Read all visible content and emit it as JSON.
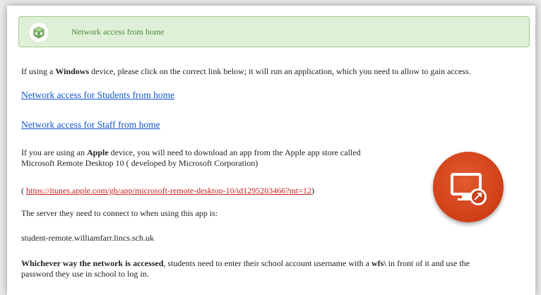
{
  "header": {
    "title": "Network access from home",
    "icon": "network-package-icon"
  },
  "intro": {
    "pre": "If using a ",
    "bold": "Windows",
    "post": " device, please click on the correct link below; it will run an application, which you need to allow to gain access."
  },
  "links": {
    "students": "Network access for Students from home",
    "staff": "Network access for Staff from home"
  },
  "apple": {
    "pre": "If you are using an ",
    "bold": "Apple",
    "post": " device, you will need to download an app from the Apple app store called",
    "line2": "Microsoft Remote Desktop 10 ( developed by Microsoft Corporation)",
    "url_open": "( ",
    "url": "https://itunes.apple.com/gb/app/microsoft-remote-desktop-10/id1295203466?mt=12",
    "url_close": ")"
  },
  "server": {
    "label": "The server they need to connect to when using this app is:",
    "host": "student-remote.williamfarr.lincs.sch.uk"
  },
  "footer": {
    "bold": "Whichever way the network is accessed",
    "mid": ", students need to enter their school account username with a ",
    "bold2": "wfs\\",
    "post": " in front of it and use the",
    "line2": "password they use in school to log in."
  },
  "remote_desktop_icon": "remote-desktop-app-icon",
  "colors": {
    "header_bg": "#dff0d8",
    "header_text": "#4f8a3b",
    "link": "#1155cc",
    "url": "#cc1f1f",
    "rd_icon": "#d4441b"
  }
}
